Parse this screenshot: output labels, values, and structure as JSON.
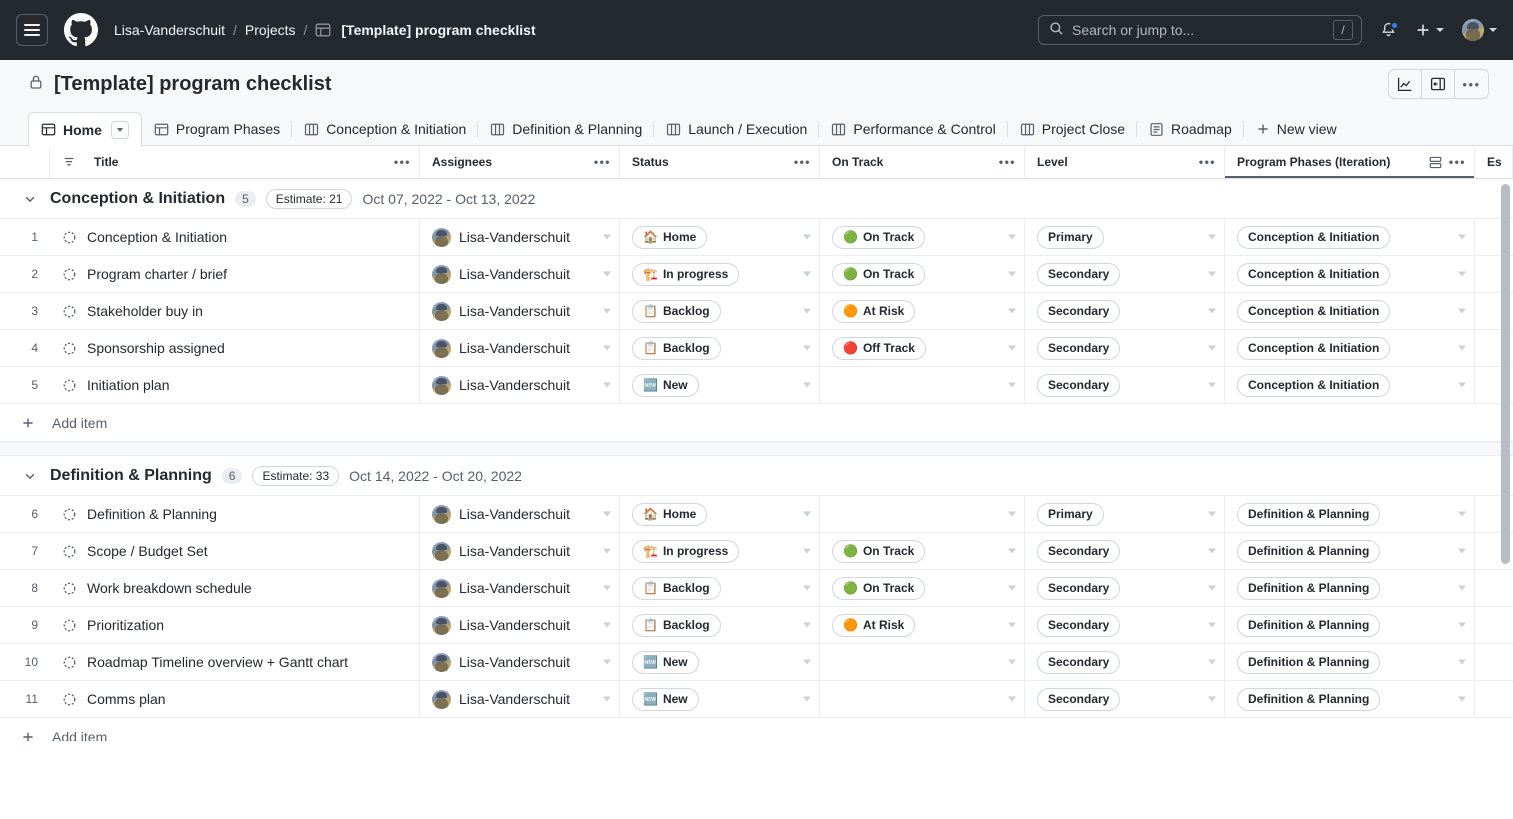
{
  "header": {
    "menu_icon": "hamburger-icon",
    "logo_icon": "github-mark-icon",
    "breadcrumb": {
      "owner": "Lisa-Vanderschuit",
      "section": "Projects",
      "project_icon": "project-table-icon",
      "current": "[Template] program checklist",
      "separator": "/"
    },
    "search": {
      "placeholder": "Search or jump to...",
      "icon": "search-icon",
      "shortcut": "/"
    },
    "notifications_icon": "bell-icon",
    "create_icon": "plus-icon",
    "avatar": "user-avatar"
  },
  "project": {
    "lock_icon": "lock-icon",
    "title": "[Template] program checklist",
    "actions": [
      {
        "name": "insights-button",
        "icon": "line-chart-icon"
      },
      {
        "name": "side-panel-button",
        "icon": "side-panel-icon"
      },
      {
        "name": "project-menu-button",
        "icon": "kebab-icon"
      }
    ]
  },
  "tabs": [
    {
      "label": "Home",
      "icon": "table-icon",
      "active": true,
      "has_caret": true
    },
    {
      "label": "Program Phases",
      "icon": "table-icon",
      "active": false
    },
    {
      "label": "Conception & Initiation",
      "icon": "board-icon",
      "active": false
    },
    {
      "label": "Definition & Planning",
      "icon": "board-icon",
      "active": false
    },
    {
      "label": "Launch / Execution",
      "icon": "board-icon",
      "active": false
    },
    {
      "label": "Performance & Control",
      "icon": "board-icon",
      "active": false
    },
    {
      "label": "Project Close",
      "icon": "board-icon",
      "active": false
    },
    {
      "label": "Roadmap",
      "icon": "roadmap-icon",
      "active": false
    }
  ],
  "new_view": {
    "label": "New view",
    "icon": "plus-icon"
  },
  "columns": [
    {
      "key": "num",
      "label": ""
    },
    {
      "key": "title",
      "label": "Title",
      "icon": "sort-icon",
      "kebab": "•••"
    },
    {
      "key": "assignees",
      "label": "Assignees",
      "kebab": "•••"
    },
    {
      "key": "status",
      "label": "Status",
      "kebab": "•••"
    },
    {
      "key": "ontrack",
      "label": "On Track",
      "kebab": "•••"
    },
    {
      "key": "level",
      "label": "Level",
      "kebab": "•••"
    },
    {
      "key": "phase",
      "label": "Program Phases (Iteration)",
      "icon": "group-by-icon",
      "kebab": "•••",
      "active": true
    },
    {
      "key": "estimate",
      "label": "Es"
    }
  ],
  "add_item": {
    "label": "Add item",
    "icon": "plus-icon"
  },
  "groups": [
    {
      "name": "Conception & Initiation",
      "count": "5",
      "estimate": "Estimate: 21",
      "dates": "Oct 07, 2022 - Oct 13, 2022",
      "collapse_icon": "chevron-down-icon",
      "rows": [
        {
          "num": "1",
          "title": "Conception & Initiation",
          "assignee": "Lisa-Vanderschuit",
          "status": "Home",
          "status_emoji": "🏠",
          "ontrack": "On Track",
          "ontrack_emoji": "🟢",
          "level": "Primary",
          "phase": "Conception & Initiation"
        },
        {
          "num": "2",
          "title": "Program charter / brief",
          "assignee": "Lisa-Vanderschuit",
          "status": "In progress",
          "status_emoji": "🏗️",
          "ontrack": "On Track",
          "ontrack_emoji": "🟢",
          "level": "Secondary",
          "phase": "Conception & Initiation"
        },
        {
          "num": "3",
          "title": "Stakeholder buy in",
          "assignee": "Lisa-Vanderschuit",
          "status": "Backlog",
          "status_emoji": "📋",
          "ontrack": "At Risk",
          "ontrack_emoji": "🟠",
          "level": "Secondary",
          "phase": "Conception & Initiation"
        },
        {
          "num": "4",
          "title": "Sponsorship assigned",
          "assignee": "Lisa-Vanderschuit",
          "status": "Backlog",
          "status_emoji": "📋",
          "ontrack": "Off Track",
          "ontrack_emoji": "🔴",
          "level": "Secondary",
          "phase": "Conception & Initiation"
        },
        {
          "num": "5",
          "title": "Initiation plan",
          "assignee": "Lisa-Vanderschuit",
          "status": "New",
          "status_emoji": "🆕",
          "ontrack": "",
          "ontrack_emoji": "",
          "level": "Secondary",
          "phase": "Conception & Initiation"
        }
      ]
    },
    {
      "name": "Definition & Planning",
      "count": "6",
      "estimate": "Estimate: 33",
      "dates": "Oct 14, 2022 - Oct 20, 2022",
      "collapse_icon": "chevron-down-icon",
      "rows": [
        {
          "num": "6",
          "title": "Definition & Planning",
          "assignee": "Lisa-Vanderschuit",
          "status": "Home",
          "status_emoji": "🏠",
          "ontrack": "",
          "ontrack_emoji": "",
          "level": "Primary",
          "phase": "Definition & Planning"
        },
        {
          "num": "7",
          "title": "Scope / Budget Set",
          "assignee": "Lisa-Vanderschuit",
          "status": "In progress",
          "status_emoji": "🏗️",
          "ontrack": "On Track",
          "ontrack_emoji": "🟢",
          "level": "Secondary",
          "phase": "Definition & Planning"
        },
        {
          "num": "8",
          "title": "Work breakdown schedule",
          "assignee": "Lisa-Vanderschuit",
          "status": "Backlog",
          "status_emoji": "📋",
          "ontrack": "On Track",
          "ontrack_emoji": "🟢",
          "level": "Secondary",
          "phase": "Definition & Planning"
        },
        {
          "num": "9",
          "title": "Prioritization",
          "assignee": "Lisa-Vanderschuit",
          "status": "Backlog",
          "status_emoji": "📋",
          "ontrack": "At Risk",
          "ontrack_emoji": "🟠",
          "level": "Secondary",
          "phase": "Definition & Planning"
        },
        {
          "num": "10",
          "title": "Roadmap Timeline overview + Gantt chart",
          "assignee": "Lisa-Vanderschuit",
          "status": "New",
          "status_emoji": "🆕",
          "ontrack": "",
          "ontrack_emoji": "",
          "level": "Secondary",
          "phase": "Definition & Planning"
        },
        {
          "num": "11",
          "title": "Comms plan",
          "assignee": "Lisa-Vanderschuit",
          "status": "New",
          "status_emoji": "🆕",
          "ontrack": "",
          "ontrack_emoji": "",
          "level": "Secondary",
          "phase": "Definition & Planning"
        }
      ]
    }
  ],
  "colors": {
    "header_bg": "#24292f",
    "accent": "#2f81f7",
    "on_track": "#1f9d2f",
    "at_risk": "#e68a00",
    "off_track": "#e02020",
    "surface": "#f6f8fa",
    "border": "#d8dee4"
  }
}
